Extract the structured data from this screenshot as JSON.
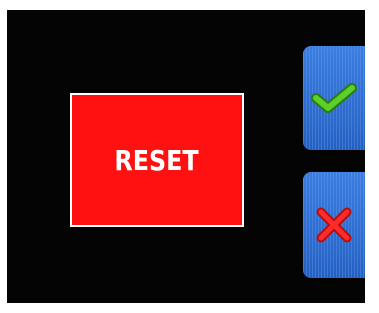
{
  "reset_button": {
    "label": "RESET",
    "color": "#ff1111"
  },
  "confirm_button": {
    "icon": "check-icon",
    "icon_color": "#5ad12a"
  },
  "cancel_button": {
    "icon": "close-icon",
    "icon_color": "#ff2a2a"
  },
  "colors": {
    "background": "#040404",
    "side_buttons": "#2d6fd1"
  }
}
